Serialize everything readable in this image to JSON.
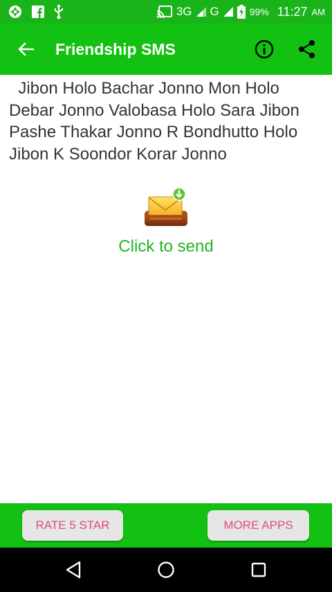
{
  "status_bar": {
    "network_primary": "3G",
    "network_secondary": "G",
    "battery": "99%",
    "time": "11:27",
    "ampm": "AM",
    "icons": [
      "sync-icon",
      "facebook-icon",
      "usb-icon",
      "cast-icon",
      "signal-icon",
      "battery-charging-icon"
    ]
  },
  "app_bar": {
    "title": "Friendship SMS",
    "icons": [
      "back-arrow-icon",
      "info-icon",
      "share-icon"
    ]
  },
  "message": {
    "text": "  Jibon Holo Bachar Jonno Mon Holo Debar Jonno Valobasa Holo Sara Jibon Pashe Thakar Jonno R Bondhutto Holo Jibon K Soondor Korar Jonno"
  },
  "send": {
    "label": "Click to send",
    "icon": "mail-send-icon"
  },
  "bottom_bar": {
    "rate_label": "RATE 5 STAR",
    "more_label": "MORE APPS"
  },
  "nav_bar": {
    "icons": [
      "nav-back-icon",
      "nav-home-icon",
      "nav-recent-icon"
    ]
  },
  "colors": {
    "status_bar": "#1ab41a",
    "app_bar": "#12c112",
    "send_label": "#1fb71f",
    "button_text": "#e34b7a",
    "button_bg": "#e6e6e6"
  }
}
